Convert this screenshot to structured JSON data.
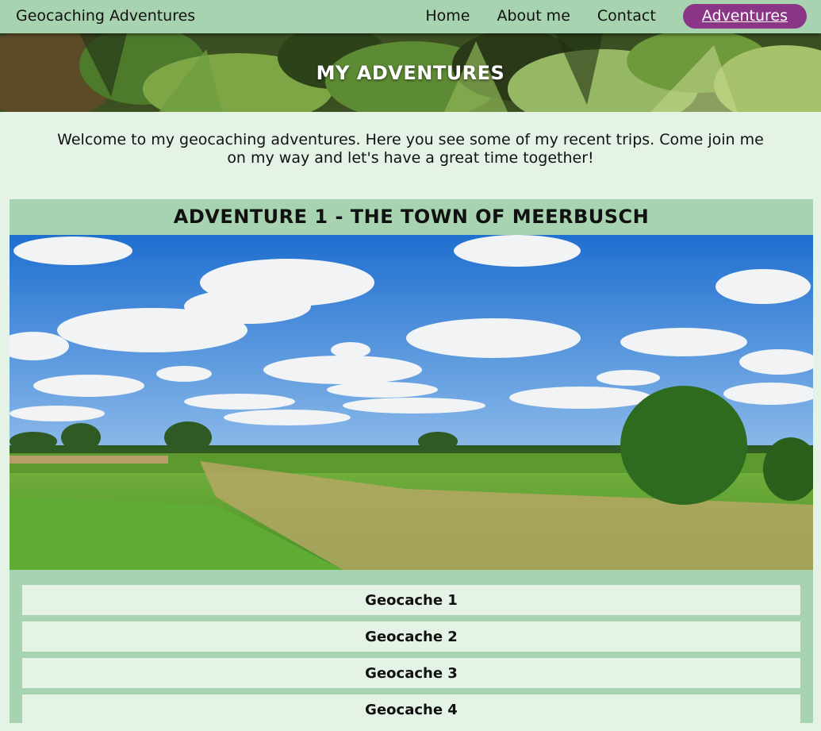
{
  "nav": {
    "brand": "Geocaching Adventures",
    "links": [
      "Home",
      "About me",
      "Contact",
      "Adventures"
    ],
    "active": "Adventures"
  },
  "hero": {
    "title": "MY ADVENTURES"
  },
  "intro": {
    "text": "Welcome to my geocaching adventures. Here you see some of my recent trips. Come join me on my way and let's have a great time together!"
  },
  "adventure": {
    "title": "ADVENTURE 1 - THE TOWN OF MEERBUSCH",
    "caches": [
      "Geocache 1",
      "Geocache 2",
      "Geocache 3",
      "Geocache 4"
    ]
  },
  "colors": {
    "nav_bg": "#a8d3b0",
    "page_bg": "#e4f3e6",
    "active_pill": "#8a3585"
  }
}
